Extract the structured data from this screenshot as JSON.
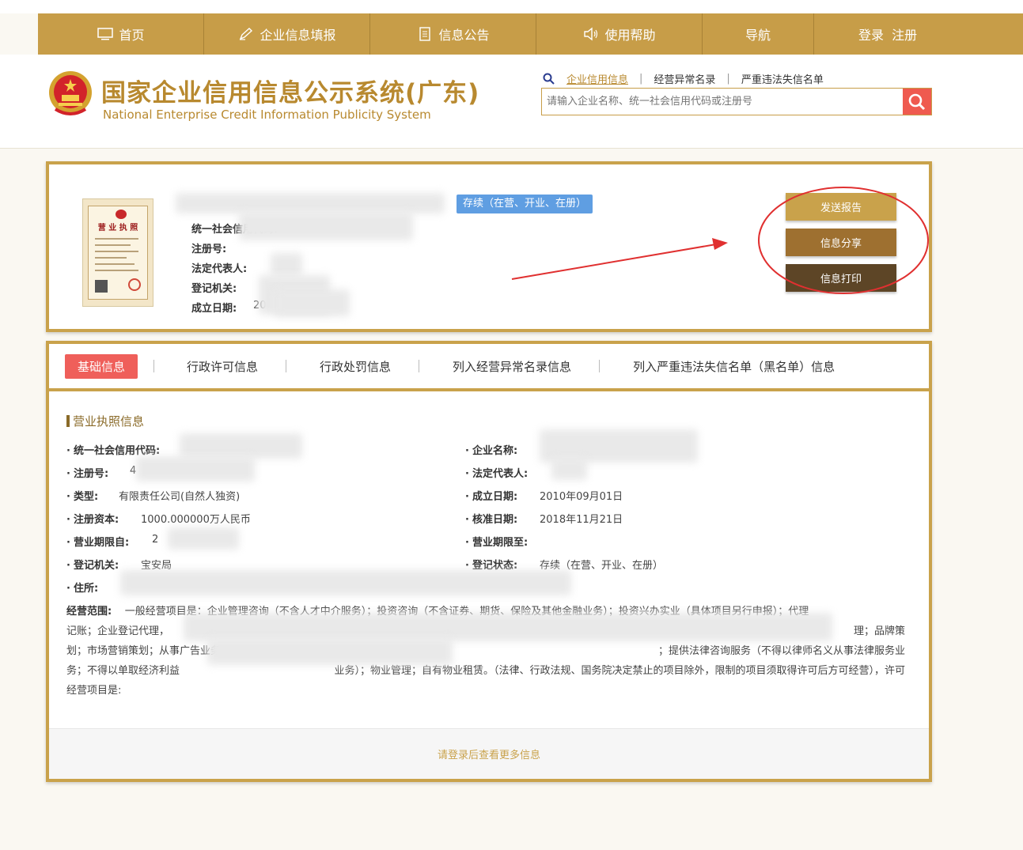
{
  "nav": {
    "items": [
      {
        "label": "首页",
        "icon": "monitor-icon"
      },
      {
        "label": "企业信息填报",
        "icon": "pen-icon"
      },
      {
        "label": "信息公告",
        "icon": "document-icon"
      },
      {
        "label": "使用帮助",
        "icon": "speaker-icon"
      },
      {
        "label": "导航",
        "icon": ""
      },
      {
        "label": "登录  注册",
        "icon": ""
      }
    ]
  },
  "header": {
    "title": "国家企业信用信息公示系统(广东)",
    "subtitle": "National Enterprise Credit Information Publicity System"
  },
  "search": {
    "tabs": [
      "企业信用信息",
      "经营异常名录",
      "严重违法失信名单"
    ],
    "placeholder": "请输入企业名称、统一社会信用代码或注册号"
  },
  "company": {
    "status": "存续（在营、开业、在册）",
    "fields": [
      {
        "label": "统一社会信用代码:",
        "value": ""
      },
      {
        "label": "注册号:",
        "value": ""
      },
      {
        "label": "法定代表人:",
        "value": ""
      },
      {
        "label": "登记机关:",
        "value": ""
      },
      {
        "label": "成立日期:",
        "value": "20"
      }
    ],
    "license_title": "营 业 执 照",
    "actions": [
      "发送报告",
      "信息分享",
      "信息打印"
    ]
  },
  "info": {
    "tabs": [
      "基础信息",
      "行政许可信息",
      "行政处罚信息",
      "列入经营异常名录信息",
      "列入严重违法失信名单（黑名单）信息"
    ],
    "section_title": "营业执照信息",
    "left": [
      {
        "label": "统一社会信用代码:",
        "value": ""
      },
      {
        "label": "注册号:",
        "value": "4"
      },
      {
        "label": "类型:",
        "value": "有限责任公司(自然人独资)"
      },
      {
        "label": "注册资本:",
        "value": "1000.000000万人民币"
      },
      {
        "label": "营业期限自:",
        "value": "2"
      },
      {
        "label": "登记机关:",
        "value": "宝安局"
      },
      {
        "label": "住所:",
        "value": ""
      }
    ],
    "right": [
      {
        "label": "企业名称:",
        "value": ""
      },
      {
        "label": "法定代表人:",
        "value": ""
      },
      {
        "label": "成立日期:",
        "value": "2010年09月01日"
      },
      {
        "label": "核准日期:",
        "value": "2018年11月21日"
      },
      {
        "label": "营业期限至:",
        "value": ""
      },
      {
        "label": "登记状态:",
        "value": "存续（在营、开业、在册）"
      }
    ],
    "scope_label": "经营范围:",
    "scope_lines": [
      "一般经营项目是：企业管理咨询（不含人才中介服务）；投资咨询（不含证券、期货、保险及其他金融业务）；投资兴办实业（具体项目另行申报）；代理",
      "记账；企业登记代理，",
      "划；市场营销策划；从事广告业务",
      "务；不得以单取经济利益",
      "经营项目是:"
    ],
    "scope_tail": [
      "理；品牌策",
      "；提供法律咨询服务（不得以律师名义从事法律服务业",
      "业务）；物业管理；自有物业租赁。（法律、行政法规、国务院决定禁止的项目除外，限制的项目须取得许可后方可经营），许可"
    ],
    "login_prompt": "请登录后查看更多信息"
  },
  "colors": {
    "brand_gold": "#c79d48",
    "accent_red": "#ef5a4f",
    "status_blue": "#5f9ee2",
    "btn_send": "#c9a24b",
    "btn_share": "#9e7030",
    "btn_print": "#5d4526"
  }
}
